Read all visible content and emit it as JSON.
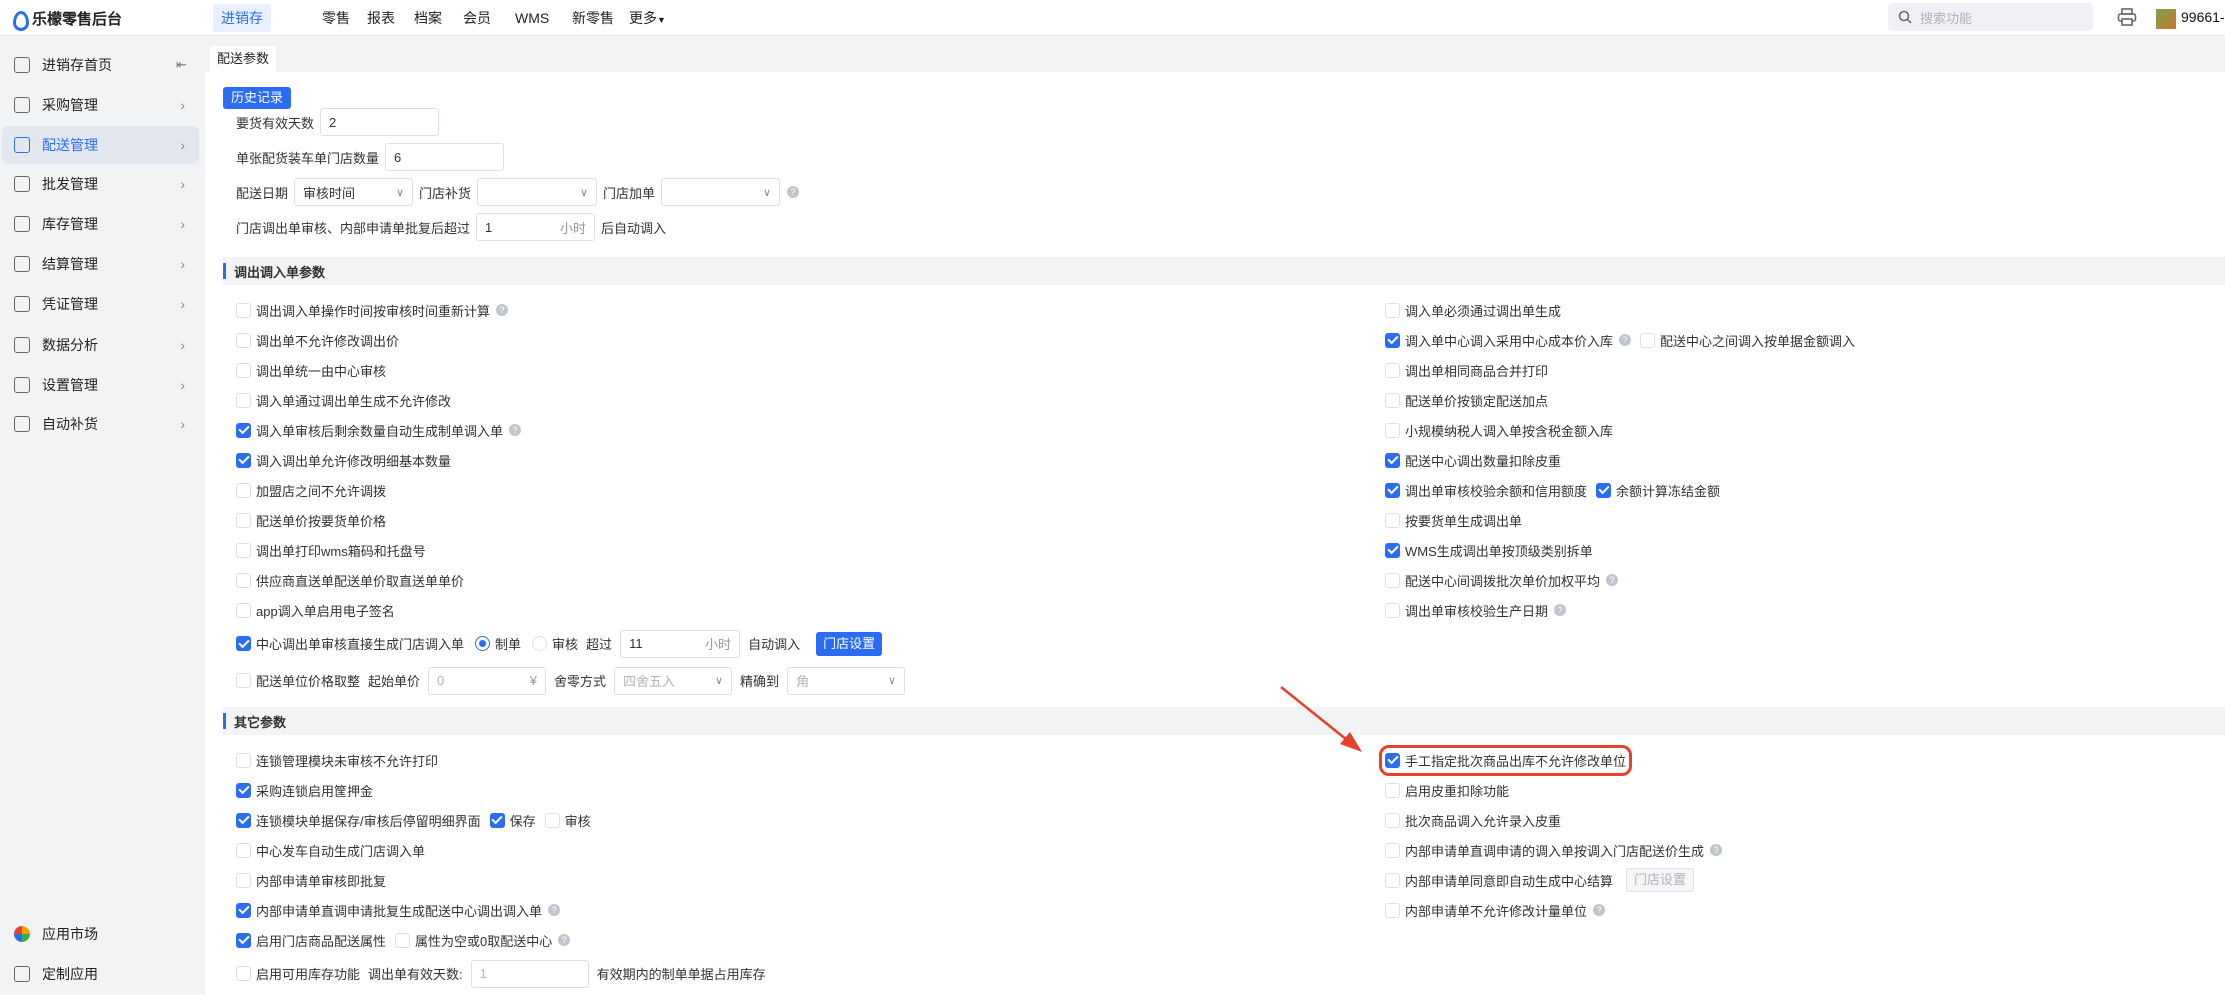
{
  "header": {
    "brand": "乐檬零售后台",
    "nav": [
      "进销存",
      "零售",
      "报表",
      "档案",
      "会员",
      "WMS",
      "新零售",
      "更多"
    ],
    "search_placeholder": "搜索功能",
    "user": "99661-"
  },
  "sidebar": {
    "items": [
      "进销存首页",
      "采购管理",
      "配送管理",
      "批发管理",
      "库存管理",
      "结算管理",
      "凭证管理",
      "数据分析",
      "设置管理",
      "自动补货"
    ],
    "active": 2,
    "bottom": [
      "应用市场",
      "定制应用"
    ]
  },
  "tab": "配送参数",
  "top_form": {
    "history_button": "历史记录",
    "valid_days_label": "要货有效天数",
    "valid_days": "2",
    "store_count_label": "单张配货装车单门店数量",
    "store_count": "6",
    "date_label": "配送日期",
    "date_value": "审核时间",
    "replenish_label": "门店补货",
    "replenish_value": "",
    "add_label": "门店加单",
    "add_value": "",
    "auto_label": "门店调出单审核、内部申请单批复后超过",
    "auto_value": "1",
    "auto_unit": "小时",
    "auto_suffix": "后自动调入"
  },
  "sections": [
    {
      "title": "调出调入单参数",
      "left": [
        [
          {
            "t": "cb",
            "label": "调出调入单操作时间按审核时间重新计算",
            "checked": false,
            "help": true
          }
        ],
        [
          {
            "t": "cb",
            "label": "调出单不允许修改调出价",
            "checked": false
          }
        ],
        [
          {
            "t": "cb",
            "label": "调出单统一由中心审核",
            "checked": false
          }
        ],
        [
          {
            "t": "cb",
            "label": "调入单通过调出单生成不允许修改",
            "checked": false
          }
        ],
        [
          {
            "t": "cb",
            "label": "调入单审核后剩余数量自动生成制单调入单",
            "checked": true,
            "help": true
          }
        ],
        [
          {
            "t": "cb",
            "label": "调入调出单允许修改明细基本数量",
            "checked": true
          }
        ],
        [
          {
            "t": "cb",
            "label": "加盟店之间不允许调拨",
            "checked": false
          }
        ],
        [
          {
            "t": "cb",
            "label": "配送单价按要货单价格",
            "checked": false
          }
        ],
        [
          {
            "t": "cb",
            "label": "调出单打印wms箱码和托盘号",
            "checked": false
          }
        ],
        [
          {
            "t": "cb",
            "label": "供应商直送单配送单价取直送单单价",
            "checked": false
          }
        ],
        [
          {
            "t": "cb",
            "label": "app调入单启用电子签名",
            "checked": false
          }
        ],
        [
          {
            "t": "cb",
            "label": "中心调出单审核直接生成门店调入单",
            "checked": true
          },
          {
            "t": "radio",
            "label": "制单",
            "checked": true
          },
          {
            "t": "radio",
            "label": "审核",
            "checked": false
          },
          {
            "t": "text",
            "label": "超过"
          },
          {
            "t": "input",
            "value": "11",
            "suffix": "小时",
            "w": 120
          },
          {
            "t": "text",
            "label": "自动调入"
          },
          {
            "t": "button",
            "label": "门店设置"
          }
        ],
        [
          {
            "t": "cb",
            "label": "配送单位价格取整",
            "checked": false
          },
          {
            "t": "text",
            "label": "起始单价"
          },
          {
            "t": "input",
            "value": "0",
            "suffix": "¥",
            "disabled": true,
            "w": 118
          },
          {
            "t": "text",
            "label": "舍零方式"
          },
          {
            "t": "select",
            "value": "四舍五入",
            "disabled": true,
            "w": 118
          },
          {
            "t": "text",
            "label": "精确到"
          },
          {
            "t": "select",
            "value": "角",
            "disabled": true,
            "w": 118
          }
        ]
      ],
      "right": [
        [
          {
            "t": "cb",
            "label": "调入单必须通过调出单生成",
            "checked": false
          }
        ],
        [
          {
            "t": "cb",
            "label": "调入单中心调入采用中心成本价入库",
            "checked": true,
            "help": true
          },
          {
            "t": "cb",
            "label": "配送中心之间调入按单据金额调入",
            "checked": false
          }
        ],
        [
          {
            "t": "cb",
            "label": "调出单相同商品合并打印",
            "checked": false
          }
        ],
        [
          {
            "t": "cb",
            "label": "配送单价按锁定配送加点",
            "checked": false
          }
        ],
        [
          {
            "t": "cb",
            "label": "小规模纳税人调入单按含税金额入库",
            "checked": false
          }
        ],
        [
          {
            "t": "cb",
            "label": "配送中心调出数量扣除皮重",
            "checked": true
          }
        ],
        [
          {
            "t": "cb",
            "label": "调出单审核校验余额和信用额度",
            "checked": true
          },
          {
            "t": "cb",
            "label": "余额计算冻结金额",
            "checked": true
          }
        ],
        [
          {
            "t": "cb",
            "label": "按要货单生成调出单",
            "checked": false
          }
        ],
        [
          {
            "t": "cb",
            "label": "WMS生成调出单按顶级类别拆单",
            "checked": true
          }
        ],
        [
          {
            "t": "cb",
            "label": "配送中心间调拨批次单价加权平均",
            "checked": false,
            "help": true
          }
        ],
        [
          {
            "t": "cb",
            "label": "调出单审核校验生产日期",
            "checked": false,
            "help": true
          }
        ]
      ]
    },
    {
      "title": "其它参数",
      "left": [
        [
          {
            "t": "cb",
            "label": "连锁管理模块未审核不允许打印",
            "checked": false
          }
        ],
        [
          {
            "t": "cb",
            "label": "采购连锁启用筐押金",
            "checked": true
          }
        ],
        [
          {
            "t": "cb",
            "label": "连锁模块单据保存/审核后停留明细界面",
            "checked": true
          },
          {
            "t": "cb",
            "label": "保存",
            "checked": true
          },
          {
            "t": "cb",
            "label": "审核",
            "checked": false
          }
        ],
        [
          {
            "t": "cb",
            "label": "中心发车自动生成门店调入单",
            "checked": false
          }
        ],
        [
          {
            "t": "cb",
            "label": "内部申请单审核即批复",
            "checked": false
          }
        ],
        [
          {
            "t": "cb",
            "label": "内部申请单直调申请批复生成配送中心调出调入单",
            "checked": true,
            "help": true
          }
        ],
        [
          {
            "t": "cb",
            "label": "启用门店商品配送属性",
            "checked": true
          },
          {
            "t": "cb",
            "label": "属性为空或0取配送中心",
            "checked": false,
            "help": true
          }
        ],
        [
          {
            "t": "cb",
            "label": "启用可用库存功能",
            "checked": false
          },
          {
            "t": "text",
            "label": "调出单有效天数:"
          },
          {
            "t": "input",
            "value": "1",
            "disabled": true,
            "w": 118
          },
          {
            "t": "text",
            "label": "有效期内的制单单据占用库存"
          }
        ]
      ],
      "right": [
        [
          {
            "t": "cb",
            "label": "手工指定批次商品出库不允许修改单位",
            "checked": true,
            "highlight": true
          }
        ],
        [
          {
            "t": "cb",
            "label": "启用皮重扣除功能",
            "checked": false
          }
        ],
        [
          {
            "t": "cb",
            "label": "批次商品调入允许录入皮重",
            "checked": false
          }
        ],
        [
          {
            "t": "cb",
            "label": "内部申请单直调申请的调入单按调入门店配送价生成",
            "checked": false,
            "help": true
          }
        ],
        [
          {
            "t": "cb",
            "label": "内部申请单同意即自动生成中心结算",
            "checked": false
          },
          {
            "t": "button",
            "label": "门店设置",
            "disabled": true
          }
        ],
        [
          {
            "t": "cb",
            "label": "内部申请单不允许修改计量单位",
            "checked": false,
            "help": true
          }
        ]
      ]
    }
  ],
  "colors": {
    "accent": "#2a6df4",
    "highlight": "#e8412b"
  }
}
